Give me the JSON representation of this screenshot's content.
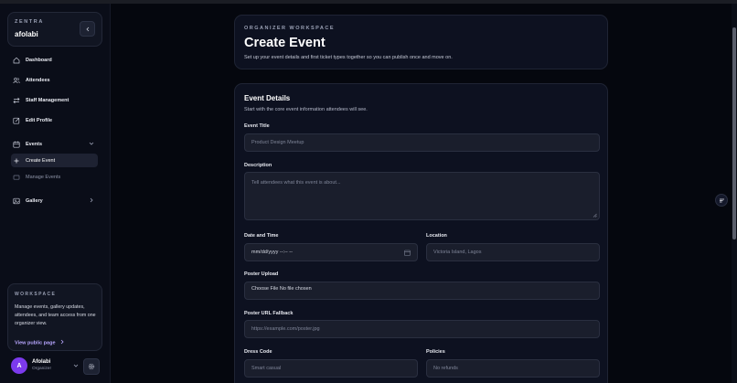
{
  "sidebar": {
    "brand": {
      "kicker": "ZENTRA",
      "name": "afolabi"
    },
    "nav": {
      "dashboard": "Dashboard",
      "attendees": "Attendees",
      "staff": "Staff Management",
      "profile": "Edit Profile",
      "events": "Events",
      "create_event": "Create Event",
      "manage_events": "Manage Events",
      "gallery": "Gallery"
    },
    "workspace": {
      "kicker": "WORKSPACE",
      "text": "Manage events, gallery updates, attendees, and team access from one organizer view.",
      "link": "View public page"
    },
    "user": {
      "initial": "A",
      "name": "Afolabi",
      "role": "Organizer"
    }
  },
  "header": {
    "kicker": "ORGANIZER WORKSPACE",
    "title": "Create Event",
    "description": "Set up your event details and first ticket types together so you can publish once and move on."
  },
  "form": {
    "title": "Event Details",
    "description": "Start with the core event information attendees will see.",
    "event_title": {
      "label": "Event Title",
      "placeholder": "Product Design Meetup"
    },
    "description_field": {
      "label": "Description",
      "placeholder": "Tell attendees what this event is about..."
    },
    "date_time": {
      "label": "Date and Time",
      "value": "mm/dd/yyyy --:-- --"
    },
    "location": {
      "label": "Location",
      "placeholder": "Victoria Island, Lagos"
    },
    "poster_upload": {
      "label": "Poster Upload",
      "value": "Choose File  No file chosen"
    },
    "poster_url": {
      "label": "Poster URL Fallback",
      "placeholder": "https://example.com/poster.jpg"
    },
    "dress_code": {
      "label": "Dress Code",
      "placeholder": "Smart casual"
    },
    "policies": {
      "label": "Policies",
      "placeholder": "No refunds"
    }
  },
  "colors": {
    "accent": "#7c3aed",
    "link": "#b8a6ff",
    "background": "#05070e",
    "card": "#0d1120"
  }
}
